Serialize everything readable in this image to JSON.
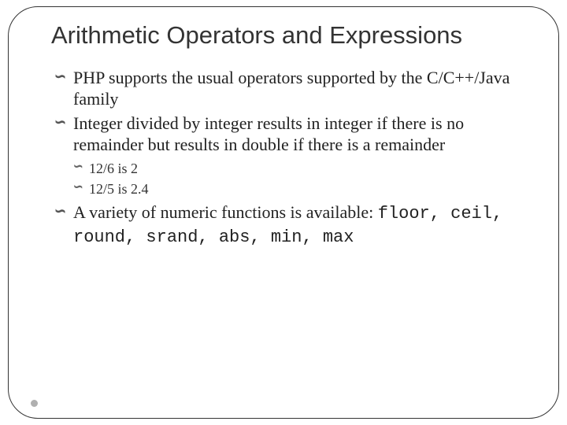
{
  "title": "Arithmetic Operators and Expressions",
  "bullets": [
    {
      "text": "PHP supports the usual operators supported by the C/C++/Java family"
    },
    {
      "text": "Integer divided by integer results in integer if there is no remainder but results in double if there is a remainder",
      "sub": [
        "12/6 is 2",
        "12/5 is 2.4"
      ]
    },
    {
      "text_prefix": "A variety of numeric functions is available: ",
      "mono": "floor, ceil, round, srand, abs, min, max"
    }
  ]
}
